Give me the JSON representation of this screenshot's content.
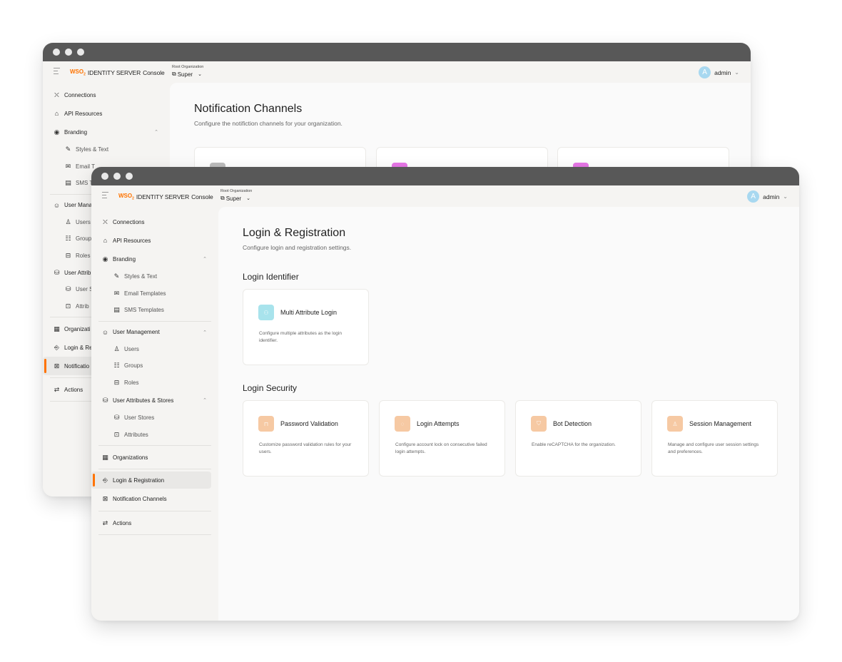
{
  "colors": {
    "accent": "#ff7300",
    "titlebar": "#585858",
    "avatar": "#a8d8f0",
    "login_icon": "#f6c9a3",
    "identifier_icon": "#a8e3ec"
  },
  "header": {
    "brand_logo": "WSO2",
    "product": "IDENTITY SERVER",
    "console": "Console",
    "org_label": "Root Organization",
    "org_value": "Super",
    "user": "admin",
    "avatar_letter": "A"
  },
  "back_window": {
    "title": "Notification Channels",
    "subtitle": "Configure the notifiction channels for your organization.",
    "nav": [
      {
        "label": "Connections",
        "icon": "connections-icon"
      },
      {
        "label": "API Resources",
        "icon": "api-icon"
      },
      {
        "label": "Branding",
        "icon": "palette-icon"
      },
      {
        "label": "Styles & Text",
        "icon": "brush-icon"
      },
      {
        "label": "Email T",
        "icon": "mail-icon"
      },
      {
        "label": "SMS T",
        "icon": "sms-icon"
      },
      {
        "label": "User Mana",
        "icon": "user-circle-icon"
      },
      {
        "label": "Users",
        "icon": "user-icon"
      },
      {
        "label": "Group",
        "icon": "group-icon"
      },
      {
        "label": "Roles",
        "icon": "roles-icon"
      },
      {
        "label": "User Attrib",
        "icon": "database-icon"
      },
      {
        "label": "User S",
        "icon": "database-icon"
      },
      {
        "label": "Attrib",
        "icon": "attribute-icon"
      },
      {
        "label": "Organizati",
        "icon": "org-icon"
      },
      {
        "label": "Login & Re",
        "icon": "login-icon"
      },
      {
        "label": "Notificatio",
        "icon": "notification-icon"
      },
      {
        "label": "Actions",
        "icon": "actions-icon"
      }
    ]
  },
  "front_window": {
    "title": "Login & Registration",
    "subtitle": "Configure login and registration settings.",
    "nav": {
      "connections": "Connections",
      "api_resources": "API Resources",
      "branding": "Branding",
      "styles_text": "Styles & Text",
      "email_templates": "Email Templates",
      "sms_templates": "SMS Templates",
      "user_management": "User Management",
      "users": "Users",
      "groups": "Groups",
      "roles": "Roles",
      "user_attributes": "User Attributes & Stores",
      "user_stores": "User Stores",
      "attributes": "Attributes",
      "organizations": "Organizations",
      "login_registration": "Login & Registration",
      "notification_channels": "Notification Channels",
      "actions": "Actions"
    },
    "login_identifier": {
      "heading": "Login Identifier",
      "cards": [
        {
          "title": "Multi Attribute Login",
          "desc": "Configure multiple attributes as the login identifier."
        }
      ]
    },
    "login_security": {
      "heading": "Login Security",
      "cards": [
        {
          "title": "Password Validation",
          "desc": "Customize password validation rules for your users."
        },
        {
          "title": "Login Attempts",
          "desc": "Configure account lock on consecutive failed login attempts."
        },
        {
          "title": "Bot Detection",
          "desc": "Enable reCAPTCHA for the organization."
        },
        {
          "title": "Session Management",
          "desc": "Manage and configure user session settings and preferences."
        }
      ]
    }
  }
}
